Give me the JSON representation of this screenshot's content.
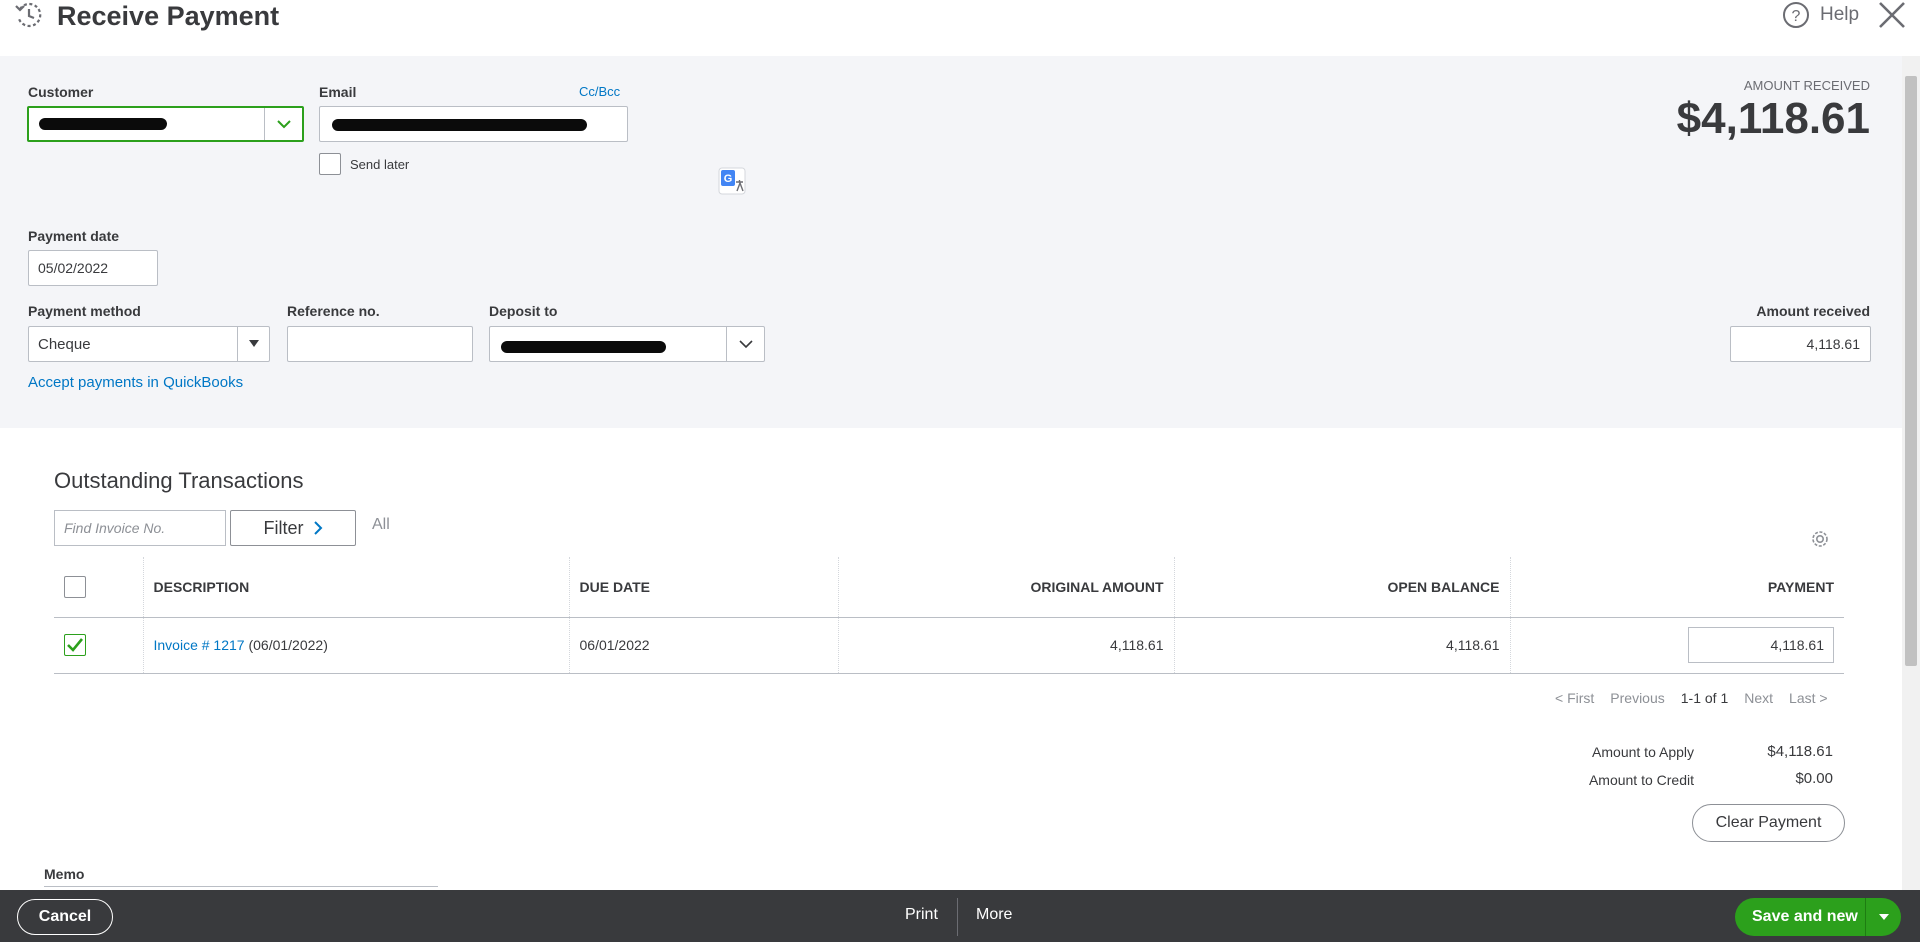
{
  "header": {
    "title": "Receive Payment",
    "help_label": "Help"
  },
  "form": {
    "customer_label": "Customer",
    "email_label": "Email",
    "ccbcc_link": "Cc/Bcc",
    "send_later_label": "Send later",
    "amount_received_caption": "AMOUNT RECEIVED",
    "amount_received_big": "$4,118.61",
    "payment_date_label": "Payment date",
    "payment_date_value": "05/02/2022",
    "payment_method_label": "Payment method",
    "payment_method_value": "Cheque",
    "reference_label": "Reference no.",
    "reference_value": "",
    "deposit_label": "Deposit to",
    "amount_received_label": "Amount received",
    "amount_received_value": "4,118.61",
    "accept_link": "Accept payments in QuickBooks"
  },
  "outstanding": {
    "title": "Outstanding Transactions",
    "find_placeholder": "Find Invoice No.",
    "filter_label": "Filter",
    "all_label": "All",
    "columns": {
      "description": "DESCRIPTION",
      "due_date": "DUE DATE",
      "original_amount": "ORIGINAL AMOUNT",
      "open_balance": "OPEN BALANCE",
      "payment": "PAYMENT"
    },
    "rows": [
      {
        "invoice_link": "Invoice # 1217",
        "invoice_date": "(06/01/2022)",
        "due_date": "06/01/2022",
        "original_amount": "4,118.61",
        "open_balance": "4,118.61",
        "payment": "4,118.61"
      }
    ],
    "pager": {
      "first": "< First",
      "previous": "Previous",
      "count": "1-1 of 1",
      "next": "Next",
      "last": "Last >"
    }
  },
  "totals": {
    "apply_label": "Amount to Apply",
    "apply_value": "$4,118.61",
    "credit_label": "Amount to Credit",
    "credit_value": "$0.00",
    "clear_button": "Clear Payment"
  },
  "memo_label": "Memo",
  "footer": {
    "cancel": "Cancel",
    "print": "Print",
    "more": "More",
    "save_new": "Save and new"
  },
  "colors": {
    "brand_green": "#2ca01c",
    "link_blue": "#0077c5",
    "footer_bg": "#393a3d"
  }
}
